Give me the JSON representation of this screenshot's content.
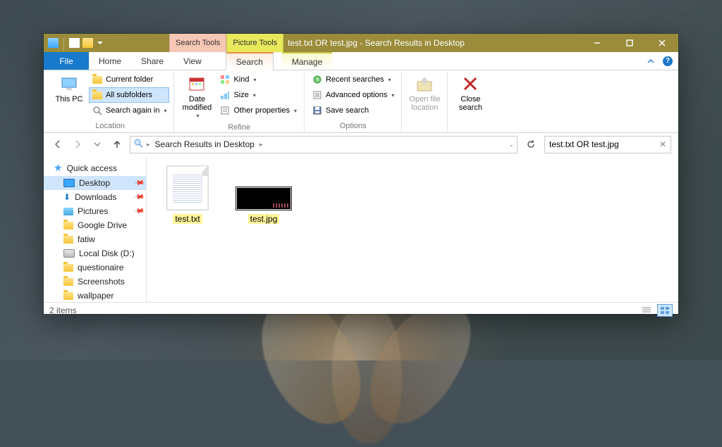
{
  "titlebar": {
    "ctx_search": "Search Tools",
    "ctx_picture": "Picture Tools",
    "title": "test.txt OR test.jpg - Search Results in Desktop"
  },
  "tabs": {
    "file": "File",
    "home": "Home",
    "share": "Share",
    "view": "View",
    "search": "Search",
    "manage": "Manage"
  },
  "ribbon": {
    "this_pc": "This PC",
    "current_folder": "Current folder",
    "all_subfolders": "All subfolders",
    "search_again_in": "Search again in",
    "location": "Location",
    "date_modified": "Date modified",
    "kind": "Kind",
    "size": "Size",
    "other_properties": "Other properties",
    "refine": "Refine",
    "recent_searches": "Recent searches",
    "advanced_options": "Advanced options",
    "save_search": "Save search",
    "options": "Options",
    "open_file_location": "Open file location",
    "close_search": "Close search"
  },
  "address": {
    "crumb": "Search Results in Desktop"
  },
  "search": {
    "value": "test.txt OR test.jpg"
  },
  "sidebar": {
    "quick_access": "Quick access",
    "desktop": "Desktop",
    "downloads": "Downloads",
    "pictures": "Pictures",
    "google_drive": "Google Drive",
    "fatiw": "fatiw",
    "local_disk": "Local Disk (D:)",
    "questionaire": "questionaire",
    "screenshots": "Screenshots",
    "wallpaper": "wallpaper"
  },
  "results": {
    "item1": "test.txt",
    "item2": "test.jpg"
  },
  "status": {
    "count": "2 items"
  }
}
